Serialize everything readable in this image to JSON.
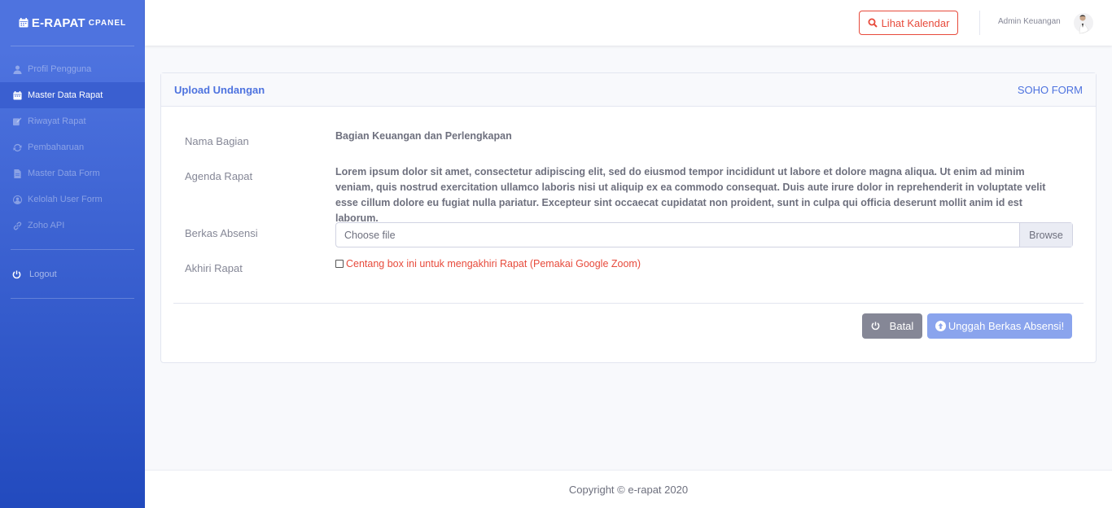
{
  "brand": {
    "name": "E-RAPAT",
    "sub": "CPANEL"
  },
  "sidebar": {
    "items": [
      {
        "label": "Profil Pengguna",
        "icon": "user-icon"
      },
      {
        "label": "Master Data Rapat",
        "icon": "calendar-icon",
        "active": true
      },
      {
        "label": "Riwayat Rapat",
        "icon": "edit-icon"
      },
      {
        "label": "Pembaharuan",
        "icon": "sync-icon"
      },
      {
        "label": "Master Data Form",
        "icon": "file-icon"
      },
      {
        "label": "Kelolah User Form",
        "icon": "user-circle-icon"
      },
      {
        "label": "Zoho API",
        "icon": "link-icon"
      }
    ],
    "logout_label": "Logout"
  },
  "topbar": {
    "calendar_button": "Lihat Kalendar",
    "user_name": "Admin Keuangan"
  },
  "card": {
    "title": "Upload Undangan",
    "form_name": "SOHO FORM",
    "fields": {
      "nama_bagian_label": "Nama Bagian",
      "nama_bagian_value": "Bagian Keuangan dan Perlengkapan",
      "agenda_label": "Agenda Rapat",
      "agenda_value": "Lorem ipsum dolor sit amet, consectetur adipiscing elit, sed do eiusmod tempor incididunt ut labore et dolore magna aliqua. Ut enim ad minim veniam, quis nostrud exercitation ullamco laboris nisi ut aliquip ex ea commodo consequat. Duis aute irure dolor in reprehenderit in voluptate velit esse cillum dolore eu fugiat nulla pariatur. Excepteur sint occaecat cupidatat non proident, sunt in culpa qui officia deserunt mollit anim id est laborum.",
      "berkas_label": "Berkas Absensi",
      "file_placeholder": "Choose file",
      "browse_label": "Browse",
      "akhiri_label": "Akhiri Rapat",
      "akhiri_checkbox_text": "Centang box ini untuk mengakhiri Rapat (Pemakai Google Zoom)",
      "akhiri_checked": false
    },
    "buttons": {
      "cancel": "Batal",
      "upload": "Unggah Berkas Absensi!"
    }
  },
  "footer": {
    "copyright": "Copyright © e-rapat 2020"
  },
  "colors": {
    "primary": "#4e73df",
    "danger": "#e74a3b",
    "secondary": "#858796"
  }
}
